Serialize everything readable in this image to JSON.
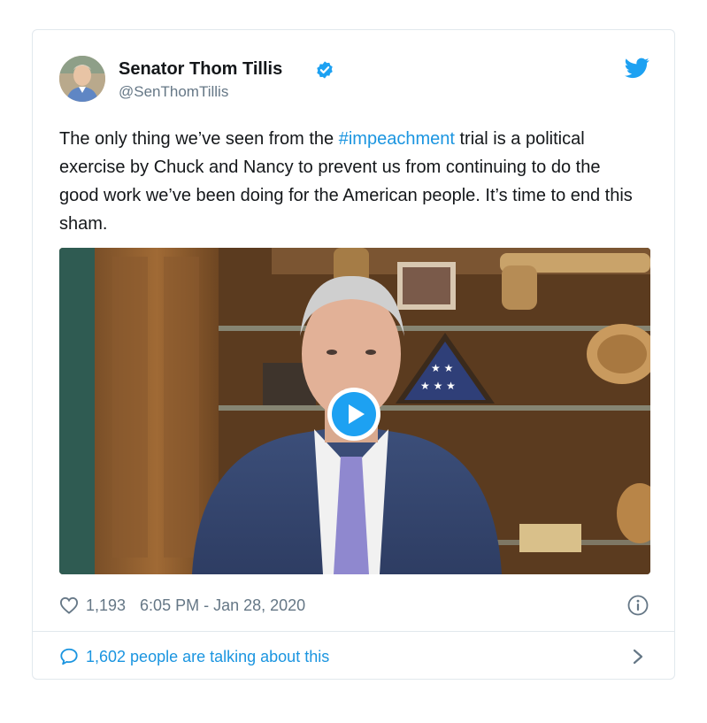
{
  "tweet": {
    "author_name": "Senator Thom Tillis",
    "author_handle": "@SenThomTillis",
    "text_before": "The only thing we’ve seen from the ",
    "hashtag": "#impeachment",
    "text_after": " trial is a political exercise by Chuck and Nancy to prevent us from continuing to do the good work we’ve been doing for the American people. It’s time to end this sham.",
    "likes": "1,193",
    "timestamp": "6:05 PM - Jan 28, 2020",
    "talking": "1,602 people are talking about this"
  },
  "icons": {
    "verified": "verified-badge-icon",
    "brand": "twitter-bird-icon",
    "like": "heart-icon",
    "info": "info-icon",
    "reply": "speech-bubble-icon",
    "more": "chevron-right-icon",
    "media": "play-icon"
  },
  "colors": {
    "accent": "#1da1f2",
    "link": "#1b95e0",
    "muted": "#657786",
    "border": "#e1e8ed"
  }
}
